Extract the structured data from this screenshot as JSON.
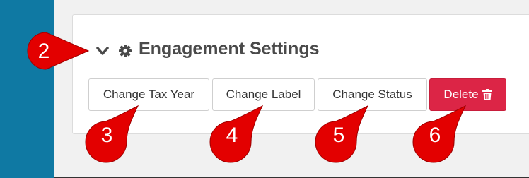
{
  "section": {
    "title": "Engagement Settings",
    "chevron_icon": "chevron-down-icon",
    "settings_icon": "gear-icon"
  },
  "buttons": {
    "change_tax_year": "Change Tax Year",
    "change_label": "Change Label",
    "change_status": "Change Status",
    "delete": "Delete",
    "delete_icon": "trash-icon"
  },
  "callouts": {
    "two": "2",
    "three": "3",
    "four": "4",
    "five": "5",
    "six": "6"
  },
  "colors": {
    "sidebar": "#0f79a3",
    "delete_button": "#dc2546",
    "callout_marker": "#e30000"
  }
}
